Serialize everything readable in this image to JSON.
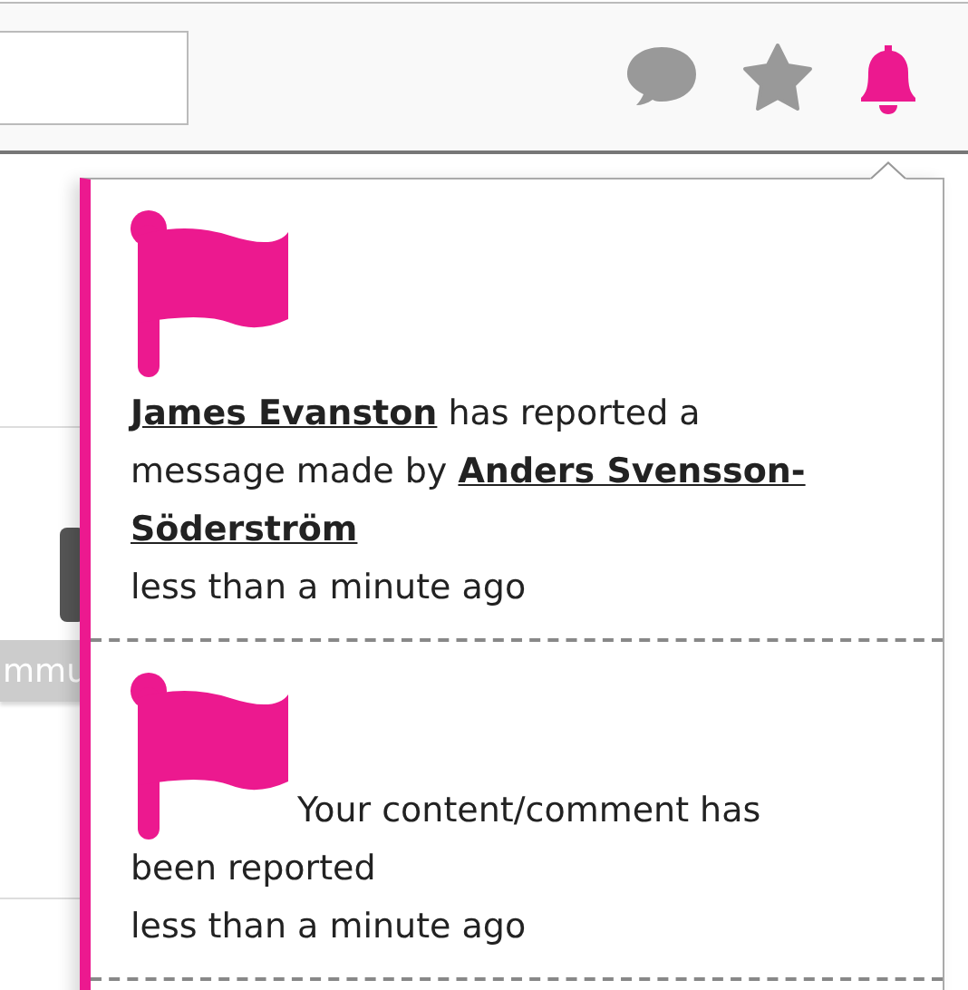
{
  "header": {
    "icons": [
      {
        "kind": "chat",
        "selected": false
      },
      {
        "kind": "star",
        "selected": false
      },
      {
        "kind": "bell",
        "selected": true
      }
    ]
  },
  "background": {
    "button_label": "mmu"
  },
  "notifications": [
    {
      "flag_inline": false,
      "message": [
        {
          "text": "James Evanston",
          "link": true
        },
        {
          "text": " has reported a message made by ",
          "link": false
        },
        {
          "text": "Anders Svensson-",
          "link": true
        },
        {
          "text": "Söderström",
          "link": true
        }
      ],
      "time": "less than a minute ago"
    },
    {
      "flag_inline": true,
      "message": [
        {
          "text": "Your content/comment has been reported",
          "link": false
        }
      ],
      "time": "less than a minute ago"
    }
  ]
}
